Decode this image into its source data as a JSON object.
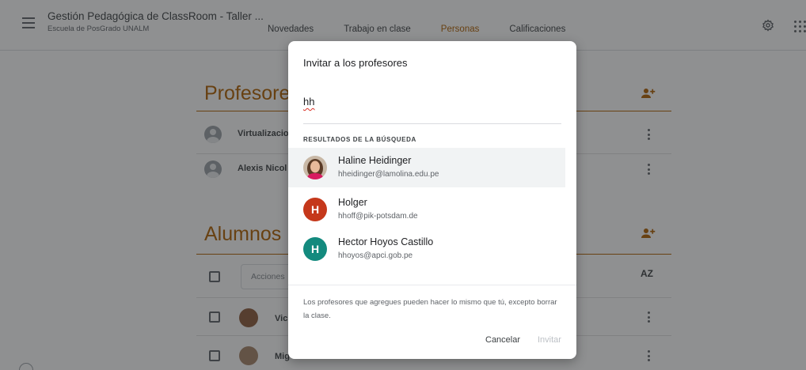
{
  "header": {
    "class_title": "Gestión Pedagógica de ClassRoom - Taller ...",
    "school": "Escuela de PosGrado UNALM",
    "tabs": [
      {
        "label": "Novedades"
      },
      {
        "label": "Trabajo en clase"
      },
      {
        "label": "Personas",
        "active": true
      },
      {
        "label": "Calificaciones"
      }
    ],
    "icons": [
      "menu-icon",
      "gear-icon",
      "apps-grid-icon"
    ]
  },
  "teachers": {
    "title": "Profesore",
    "rows": [
      {
        "name": "Virtualizacio"
      },
      {
        "name": "Alexis Nicol"
      }
    ]
  },
  "students": {
    "title": "Alumnos",
    "actions_label": "Acciones",
    "sort_label": "AZ",
    "rows": [
      {
        "name": "Vic"
      },
      {
        "name": "Mig"
      }
    ]
  },
  "dialog": {
    "title": "Invitar a los profesores",
    "search_value": "hh",
    "results_header": "RESULTADOS DE LA BÚSQUEDA",
    "results": [
      {
        "name": "Haline Heidinger",
        "email": "hheidinger@lamolina.edu.pe",
        "avatar_type": "photo"
      },
      {
        "name": "Holger",
        "email": "hhoff@pik-potsdam.de",
        "initial": "H",
        "color": "#c5381b"
      },
      {
        "name": "Hector Hoyos Castillo",
        "email": "hhoyos@apci.gob.pe",
        "initial": "H",
        "color": "#138a7e"
      }
    ],
    "note": "Los profesores que agregues pueden hacer lo mismo que tú, excepto borrar la clase.",
    "cancel_label": "Cancelar",
    "invite_label": "Invitar"
  },
  "colors": {
    "accent": "#b06000",
    "scrim": "rgba(32,33,36,0.5)"
  }
}
